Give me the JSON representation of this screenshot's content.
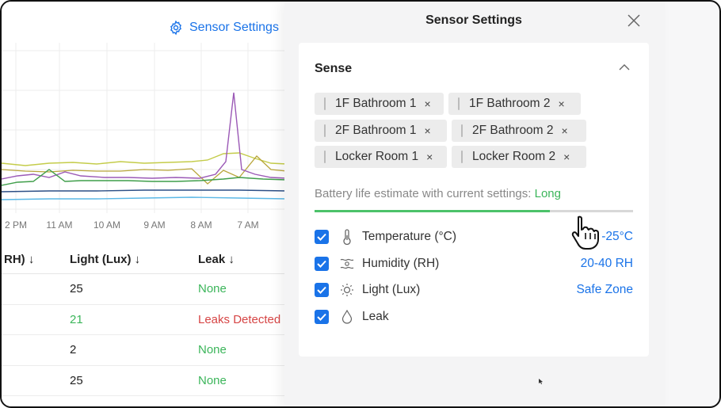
{
  "header": {
    "settings_link": "Sensor Settings"
  },
  "chart_data": {
    "type": "line",
    "x_tick_labels": [
      "2 PM",
      "11 AM",
      "10 AM",
      "9 AM",
      "8 AM",
      "7 AM"
    ],
    "grid": true
  },
  "table": {
    "headers": [
      "RH) ↓",
      "Light (Lux) ↓",
      "Leak ↓"
    ],
    "rows": [
      {
        "light": "25",
        "leak": "None",
        "status": "ok"
      },
      {
        "light": "21",
        "leak": "Leaks Detected",
        "status": "alert"
      },
      {
        "light": "2",
        "leak": "None",
        "status": "ok"
      },
      {
        "light": "25",
        "leak": "None",
        "status": "ok"
      }
    ]
  },
  "panel": {
    "title": "Sensor Settings",
    "section_title": "Sense",
    "rooms": [
      "1F Bathroom 1",
      "1F Bathroom 2",
      "2F Bathroom 1",
      "2F Bathroom 2",
      "Locker Room 1",
      "Locker Room 2"
    ],
    "chip_remove": "×",
    "battery_label": "Battery life estimate with current settings:",
    "battery_value": "Long",
    "battery_fraction": 0.74,
    "options": [
      {
        "label": "Temperature (°C)",
        "value": "-25°C",
        "checked": true,
        "icon": "thermometer-icon"
      },
      {
        "label": "Humidity (RH)",
        "value": "20-40 RH",
        "checked": true,
        "icon": "humidity-icon"
      },
      {
        "label": "Light (Lux)",
        "value": "Safe Zone",
        "checked": true,
        "icon": "sun-icon"
      },
      {
        "label": "Leak",
        "value": "",
        "checked": true,
        "icon": "droplet-icon"
      }
    ]
  },
  "colors": {
    "accent": "#1a73e8",
    "ok": "#3bb55a",
    "alert": "#d64545"
  }
}
